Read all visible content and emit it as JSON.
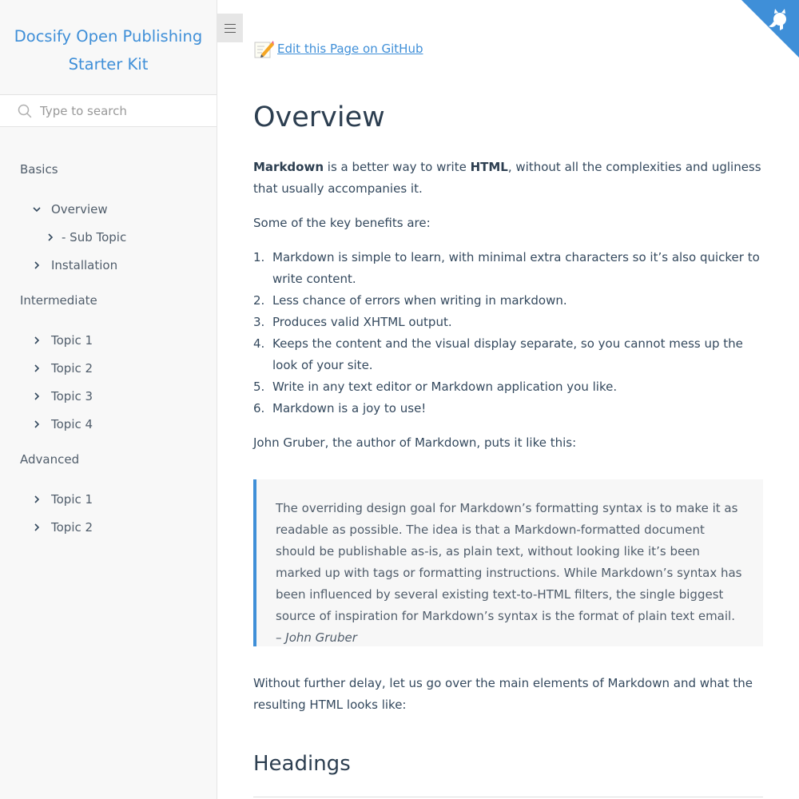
{
  "sidebar": {
    "app_name_line1": "Docsify Open Publishing",
    "app_name_line2": "Starter Kit",
    "search_placeholder": "Type to search",
    "groups": [
      {
        "label": "Basics"
      },
      {
        "label": "Intermediate"
      },
      {
        "label": "Advanced"
      }
    ],
    "basics_items": [
      "Overview",
      "- Sub Topic",
      "Installation"
    ],
    "intermediate_items": [
      "Topic 1",
      "Topic 2",
      "Topic 3",
      "Topic 4"
    ],
    "advanced_items": [
      "Topic 1",
      "Topic 2"
    ]
  },
  "content": {
    "edit_link": "Edit this Page on GitHub",
    "title": "Overview",
    "intro_bold1": "Markdown",
    "intro_mid": " is a better way to write ",
    "intro_bold2": "HTML",
    "intro_rest": ", without all the complexities and ugliness that usually accompanies it.",
    "benefits_intro": "Some of the key benefits are:",
    "benefits": [
      {
        "num": "1.",
        "text": "Markdown is simple to learn, with minimal extra characters so it’s also quicker to write content."
      },
      {
        "num": "2.",
        "text": "Less chance of errors when writing in markdown."
      },
      {
        "num": "3.",
        "text": "Produces valid XHTML output."
      },
      {
        "num": "4.",
        "text": "Keeps the content and the visual display separate, so you cannot mess up the look of your site."
      },
      {
        "num": "5.",
        "text": "Write in any text editor or Markdown application you like."
      },
      {
        "num": "6.",
        "text": "Markdown is a joy to use!"
      }
    ],
    "quote_intro": "John Gruber, the author of Markdown, puts it like this:",
    "quote_text": "The overriding design goal for Markdown’s formatting syntax is to make it as readable as possible. The idea is that a Markdown-formatted document should be publishable as-is, as plain text, without looking like it’s been marked up with tags or formatting instructions. While Markdown’s syntax has been influenced by several existing text-to-HTML filters, the single biggest source of inspiration for Markdown’s syntax is the format of plain text email. – ",
    "quote_author": "John Gruber",
    "outro": "Without further delay, let us go over the main elements of Markdown and what the resulting HTML looks like:",
    "section_heading": "Headings"
  },
  "colors": {
    "accent": "#3f8fd8",
    "sidebar_bg": "#f8f8f8",
    "text": "#34495e"
  },
  "icons": {
    "search": "search-icon",
    "toggle": "hamburger-menu-icon",
    "edit": "pencil-memo-icon",
    "corner": "github-octocat-icon",
    "expanded": "chevron-down-icon",
    "collapsed": "chevron-right-icon"
  }
}
